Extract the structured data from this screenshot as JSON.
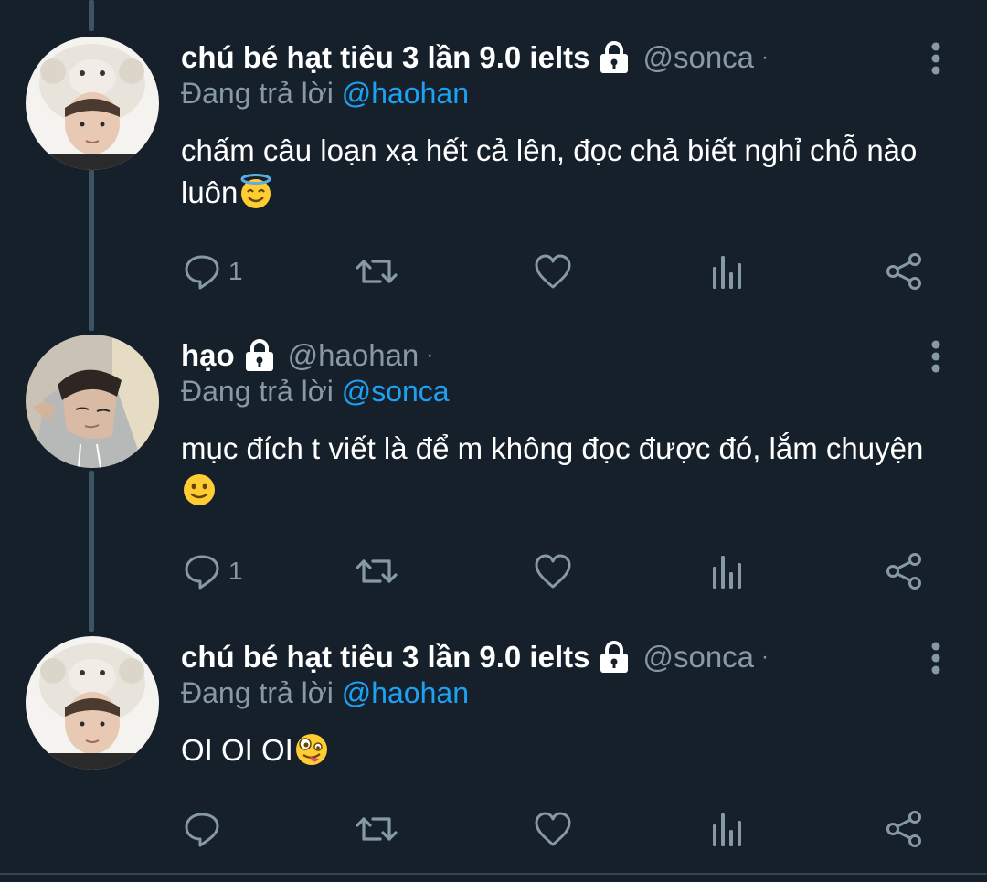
{
  "tweets": [
    {
      "display_name": "chú bé hạt tiêu 3 lần 9.0 ielts",
      "handle": "@sonca",
      "separator": "·",
      "reply_prefix": "Đang trả lời",
      "reply_to": "@haohan",
      "text": "chấm câu loạn xạ hết cả lên, đọc chả biết nghỉ chỗ nào luôn",
      "emoji": "smiling-face-with-halo",
      "reply_count": "1",
      "retweet_count": "",
      "like_count": ""
    },
    {
      "display_name": "hạo",
      "handle": "@haohan",
      "separator": "·",
      "reply_prefix": "Đang trả lời",
      "reply_to": "@sonca",
      "text": "mục đích t viết là để m không đọc được đó, lắm chuyện",
      "emoji": "slightly-smiling-face",
      "reply_count": "1",
      "retweet_count": "",
      "like_count": ""
    },
    {
      "display_name": "chú bé hạt tiêu 3 lần 9.0 ielts",
      "handle": "@sonca",
      "separator": "·",
      "reply_prefix": "Đang trả lời",
      "reply_to": "@haohan",
      "text": "OI OI OI",
      "emoji": "zany-face",
      "reply_count": "",
      "retweet_count": "",
      "like_count": ""
    }
  ],
  "icons": {
    "reply": "reply-icon",
    "retweet": "retweet-icon",
    "like": "heart-icon",
    "analytics": "analytics-icon",
    "share": "share-icon",
    "lock": "lock-icon",
    "more": "more-vertical-icon"
  },
  "colors": {
    "background": "#15202b",
    "text_primary": "#ffffff",
    "text_secondary": "#8899a6",
    "mention": "#1da1f2",
    "thread_line": "#3d5466"
  }
}
